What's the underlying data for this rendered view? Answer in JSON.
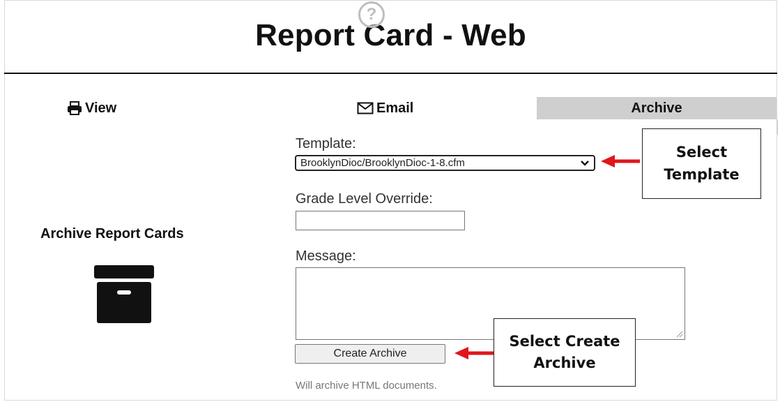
{
  "header": {
    "title": "Report Card - Web"
  },
  "tabs": {
    "view": "View",
    "email": "Email",
    "archive": "Archive"
  },
  "left_panel": {
    "title": "Archive Report Cards"
  },
  "form": {
    "template_label": "Template:",
    "template_value": "BrooklynDioc/BrooklynDioc-1-8.cfm",
    "grade_label": "Grade Level Override:",
    "grade_value": "",
    "message_label": "Message:",
    "message_value": "",
    "button_label": "Create Archive",
    "hint": "Will archive HTML documents."
  },
  "callouts": {
    "template_line1": "Select",
    "template_line2": "Template",
    "archive_line1": "Select Create",
    "archive_line2": "Archive"
  },
  "colors": {
    "arrow": "#e0161b",
    "active_tab": "#cfcfcf"
  },
  "icons": [
    "help-icon",
    "printer-icon",
    "envelope-icon",
    "archive-box-icon",
    "chevron-down-icon",
    "resize-grip-icon",
    "arrow-left-icon"
  ]
}
